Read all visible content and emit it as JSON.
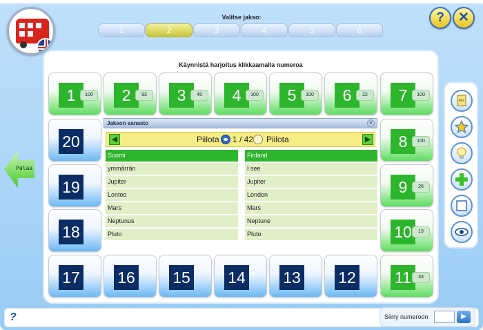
{
  "header": {
    "period_label": "Valitse jakso:",
    "period_tabs": [
      {
        "label": "1"
      },
      {
        "label": "2",
        "active": true
      },
      {
        "label": "3"
      },
      {
        "label": "4"
      },
      {
        "label": "5"
      },
      {
        "label": "6"
      }
    ],
    "help_button_label": "?",
    "close_button_label": "✕"
  },
  "main": {
    "title": "Käynnistä harjoitus klikkaamalla numeroa",
    "tiles": [
      {
        "number": "1",
        "score": "100"
      },
      {
        "number": "2",
        "score": "93"
      },
      {
        "number": "3",
        "score": "45"
      },
      {
        "number": "4",
        "score": "100"
      },
      {
        "number": "5",
        "score": "100"
      },
      {
        "number": "6",
        "score": "22"
      },
      {
        "number": "7",
        "score": "100"
      },
      {
        "number": "8",
        "score": "100"
      },
      {
        "number": "9",
        "score": "26"
      },
      {
        "number": "10",
        "score": "13"
      },
      {
        "number": "11",
        "score": "33"
      },
      {
        "number": "12"
      },
      {
        "number": "13"
      },
      {
        "number": "14"
      },
      {
        "number": "15"
      },
      {
        "number": "16"
      },
      {
        "number": "17"
      },
      {
        "number": "18"
      },
      {
        "number": "19"
      },
      {
        "number": "20"
      }
    ]
  },
  "vocab": {
    "title": "Jakson sanasto",
    "hide_left": "Piilota",
    "counter": "1 / 42",
    "hide_right": "Piilota",
    "left_column": [
      "Suomi",
      "ymmärrän",
      "Jupiter",
      "Lontoo",
      "Mars",
      "Neptunus",
      "Pluto"
    ],
    "right_column": [
      "Finland",
      "I see",
      "Jupiter",
      "London",
      "Mars",
      "Neptune",
      "Pluto"
    ]
  },
  "back_button": {
    "label": "Palaa"
  },
  "bottom": {
    "help_label": "?",
    "goto_label": "Siirry numeroon",
    "goto_value": "",
    "goto_button_glyph": "▶"
  },
  "colors": {
    "green": "#2db52d",
    "navy": "#0b2d63",
    "accent_yellow": "#f4ec85"
  },
  "toolbar": {
    "icons": [
      "notebook-icon",
      "star-icon",
      "lightbulb-icon",
      "plus-icon",
      "card-icon",
      "eye-icon"
    ]
  }
}
